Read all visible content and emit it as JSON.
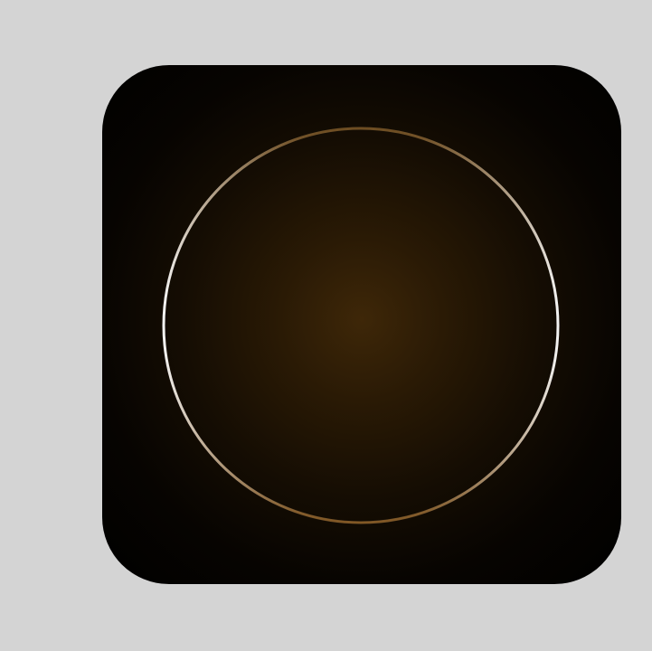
{
  "background_color": "#d4d4d4",
  "icon": {
    "semantic": "app-icon-with-glowing-ring",
    "inner_glow_color": "#3e2708",
    "outer_color": "#000000",
    "ring_highlight_color": "#ffffff",
    "ring_shadow_color": "#8a5a22"
  }
}
